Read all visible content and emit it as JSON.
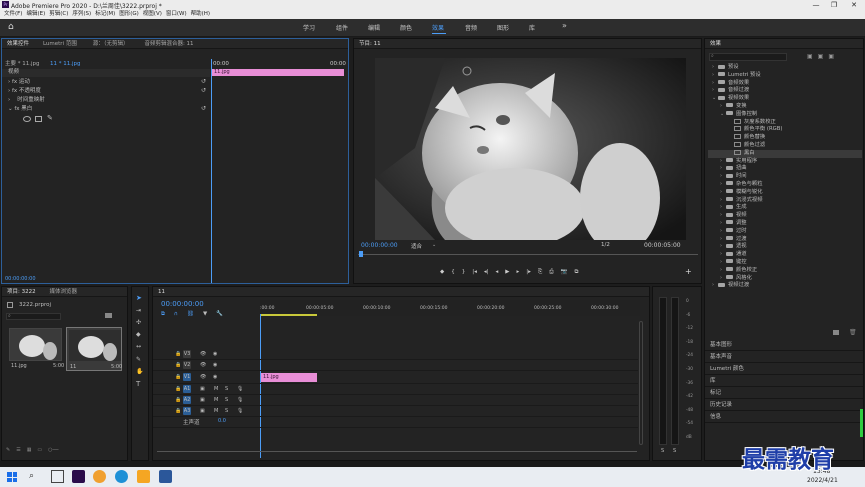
{
  "app": {
    "title": "Adobe Premiere Pro 2020 - D:\\兰周佳\\3222.prproj *",
    "logo": "Pr"
  },
  "window_controls": {
    "minimize": "—",
    "restore": "❐",
    "close": "✕"
  },
  "menu": [
    "文件(F)",
    "编辑(E)",
    "剪辑(C)",
    "序列(S)",
    "标记(M)",
    "图形(G)",
    "视图(V)",
    "窗口(W)",
    "帮助(H)"
  ],
  "workspaces": [
    "学习",
    "组件",
    "编辑",
    "颜色",
    "效果",
    "音频",
    "图形",
    "库"
  ],
  "workspace_active": "效果",
  "workspace_more": "»",
  "effect_controls": {
    "tabs": [
      "效果控件",
      "Lumetri 范围",
      "源：（无剪辑）",
      "音频剪辑混合器: 11"
    ],
    "source": "主要 * 11.jpg",
    "clip": "11 * 11.jpg",
    "tc_start": "00:00",
    "tc_end": "00:00",
    "section": "视频",
    "props": [
      "运动",
      "不透明度",
      "时间重映射",
      "黑白"
    ],
    "clip_label": "11.jpg",
    "timecode": "00:00:00:00"
  },
  "program": {
    "title": "节目: 11",
    "timecode": "00:00:00:00",
    "fit": "适合",
    "quality": "1/2",
    "duration": "00:00:05:00",
    "transport": [
      "◆",
      "{",
      "}",
      "|◂",
      "◂|",
      "◂",
      "▶",
      "▸",
      "|▸",
      "⎘",
      "⎙",
      "📷",
      "⧉"
    ],
    "add": "+"
  },
  "project": {
    "tabs": [
      "项目: 3222",
      "媒体浏览器"
    ],
    "file": "3222.prproj",
    "items": [
      {
        "name": "11.jpg",
        "dur": "5:00"
      },
      {
        "name": "11",
        "dur": "5:00"
      }
    ]
  },
  "timeline": {
    "tab": "11",
    "timecode": "00:00:00:00",
    "ruler": [
      ":00:00",
      "00:00:05:00",
      "00:00:10:00",
      "00:00:15:00",
      "00:00:20:00",
      "00:00:25:00",
      "00:00:30:00"
    ],
    "video_tracks": [
      "V3",
      "V2",
      "V1"
    ],
    "audio_tracks": [
      "A1",
      "A2",
      "A3"
    ],
    "master": "主声道",
    "master_val": "0.0",
    "clip": "11.jpg",
    "track_flags": [
      "M",
      "S"
    ]
  },
  "meter": {
    "scale": [
      "0",
      "-6",
      "-12",
      "-18",
      "-24",
      "-30",
      "-36",
      "-42",
      "-48",
      "-54",
      "dB"
    ],
    "bottom": [
      "S",
      "S"
    ]
  },
  "effects": {
    "title": "效果",
    "items": [
      {
        "label": "预设",
        "indent": 0,
        "type": "folder"
      },
      {
        "label": "Lumetri 预设",
        "indent": 0,
        "type": "folder"
      },
      {
        "label": "音频效果",
        "indent": 0,
        "type": "folder"
      },
      {
        "label": "音频过渡",
        "indent": 0,
        "type": "folder"
      },
      {
        "label": "视频效果",
        "indent": 0,
        "type": "folder"
      },
      {
        "label": "变换",
        "indent": 1,
        "type": "folder"
      },
      {
        "label": "图像控制",
        "indent": 1,
        "type": "folder"
      },
      {
        "label": "灰度系数校正",
        "indent": 2,
        "type": "fx"
      },
      {
        "label": "颜色平衡 (RGB)",
        "indent": 2,
        "type": "fx"
      },
      {
        "label": "颜色替换",
        "indent": 2,
        "type": "fx"
      },
      {
        "label": "颜色过滤",
        "indent": 2,
        "type": "fx"
      },
      {
        "label": "黑白",
        "indent": 2,
        "type": "fx",
        "selected": true
      },
      {
        "label": "实用程序",
        "indent": 1,
        "type": "folder"
      },
      {
        "label": "扭曲",
        "indent": 1,
        "type": "folder"
      },
      {
        "label": "时间",
        "indent": 1,
        "type": "folder"
      },
      {
        "label": "杂色与颗粒",
        "indent": 1,
        "type": "folder"
      },
      {
        "label": "模糊与锐化",
        "indent": 1,
        "type": "folder"
      },
      {
        "label": "沉浸式视频",
        "indent": 1,
        "type": "folder"
      },
      {
        "label": "生成",
        "indent": 1,
        "type": "folder"
      },
      {
        "label": "视频",
        "indent": 1,
        "type": "folder"
      },
      {
        "label": "调整",
        "indent": 1,
        "type": "folder"
      },
      {
        "label": "过时",
        "indent": 1,
        "type": "folder"
      },
      {
        "label": "过渡",
        "indent": 1,
        "type": "folder"
      },
      {
        "label": "透视",
        "indent": 1,
        "type": "folder"
      },
      {
        "label": "通道",
        "indent": 1,
        "type": "folder"
      },
      {
        "label": "键控",
        "indent": 1,
        "type": "folder"
      },
      {
        "label": "颜色校正",
        "indent": 1,
        "type": "folder"
      },
      {
        "label": "风格化",
        "indent": 1,
        "type": "folder"
      },
      {
        "label": "视频过渡",
        "indent": 0,
        "type": "folder"
      }
    ],
    "collapsed": [
      "基本图形",
      "基本声音",
      "Lumetri 颜色",
      "库",
      "标记",
      "历史记录",
      "信息"
    ]
  },
  "taskbar": {
    "time": "15:48",
    "date": "2022/4/21"
  },
  "watermark": "最需教育",
  "colors": {
    "accent": "#4c9df7",
    "clip": "#e88ed6",
    "selected": "#3a3a3a"
  }
}
